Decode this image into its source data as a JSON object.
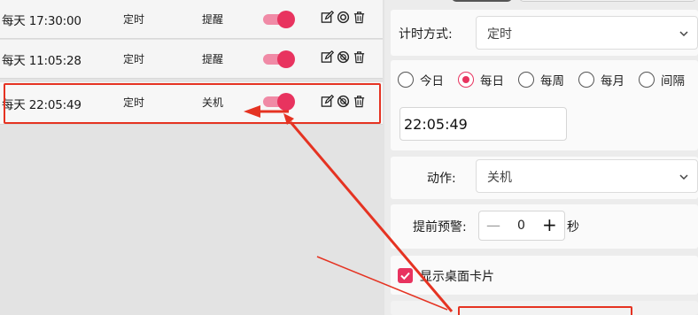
{
  "tasks": [
    {
      "time": "每天 17:30:00",
      "type": "定时",
      "action": "提醒",
      "enabled": true
    },
    {
      "time": "每天 11:05:28",
      "type": "定时",
      "action": "提醒",
      "enabled": true
    },
    {
      "time": "每天 22:05:49",
      "type": "定时",
      "action": "关机",
      "enabled": true
    }
  ],
  "settings": {
    "timing_mode_label": "计时方式:",
    "timing_mode_value": "定时",
    "repeat_options": [
      "今日",
      "每日",
      "每周",
      "每月",
      "间隔"
    ],
    "repeat_selected": "每日",
    "time_value": "22:05:49",
    "action_label": "动作:",
    "action_value": "关机",
    "advance_warning_label": "提前预警:",
    "advance_warning_value": "0",
    "advance_warning_unit": "秒",
    "minus_symbol": "—",
    "plus_symbol": "+",
    "show_card_label": "显示桌面卡片",
    "show_card_checked": true
  },
  "colors": {
    "accent": "#e8335f",
    "toggle_track": "#f08aa6",
    "annotation": "#e53322"
  },
  "icons": [
    "edit-icon",
    "disable-icon",
    "trash-icon",
    "chevron-down-icon",
    "check-icon"
  ]
}
